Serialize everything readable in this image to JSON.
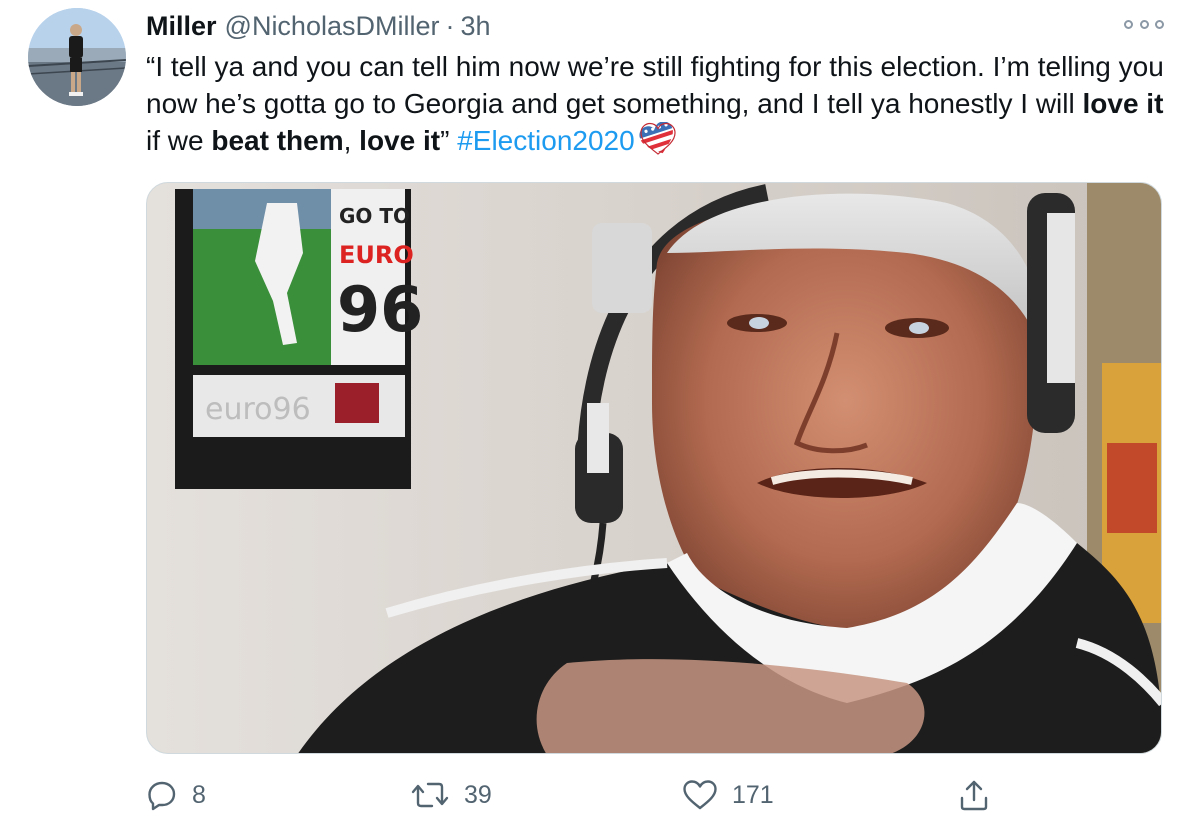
{
  "tweet": {
    "author_name": "Miller",
    "author_handle": "@NicholasDMiller",
    "separator": "·",
    "time": "3h",
    "text_segments": {
      "a": "“I tell ya and you can tell him now we’re still fighting for this election. I’m telling you now he’s gotta go to Georgia and get something, and I tell ya honestly I will ",
      "b": "love it",
      "c": " if we ",
      "d": "beat them",
      "e": ", ",
      "f": "love it",
      "g": "” ",
      "hashtag": "#Election2020"
    },
    "emoji": "us-flag-heart-emoji",
    "media_description_icon": "photo"
  },
  "actions": {
    "reply_count": "8",
    "retweet_count": "39",
    "like_count": "171"
  },
  "icons": {
    "more": "more-options-icon",
    "reply": "reply-icon",
    "retweet": "retweet-icon",
    "like": "heart-icon",
    "share": "share-icon"
  },
  "colors": {
    "text": "#0f1419",
    "secondary": "#536471",
    "link": "#1d9bf0"
  }
}
